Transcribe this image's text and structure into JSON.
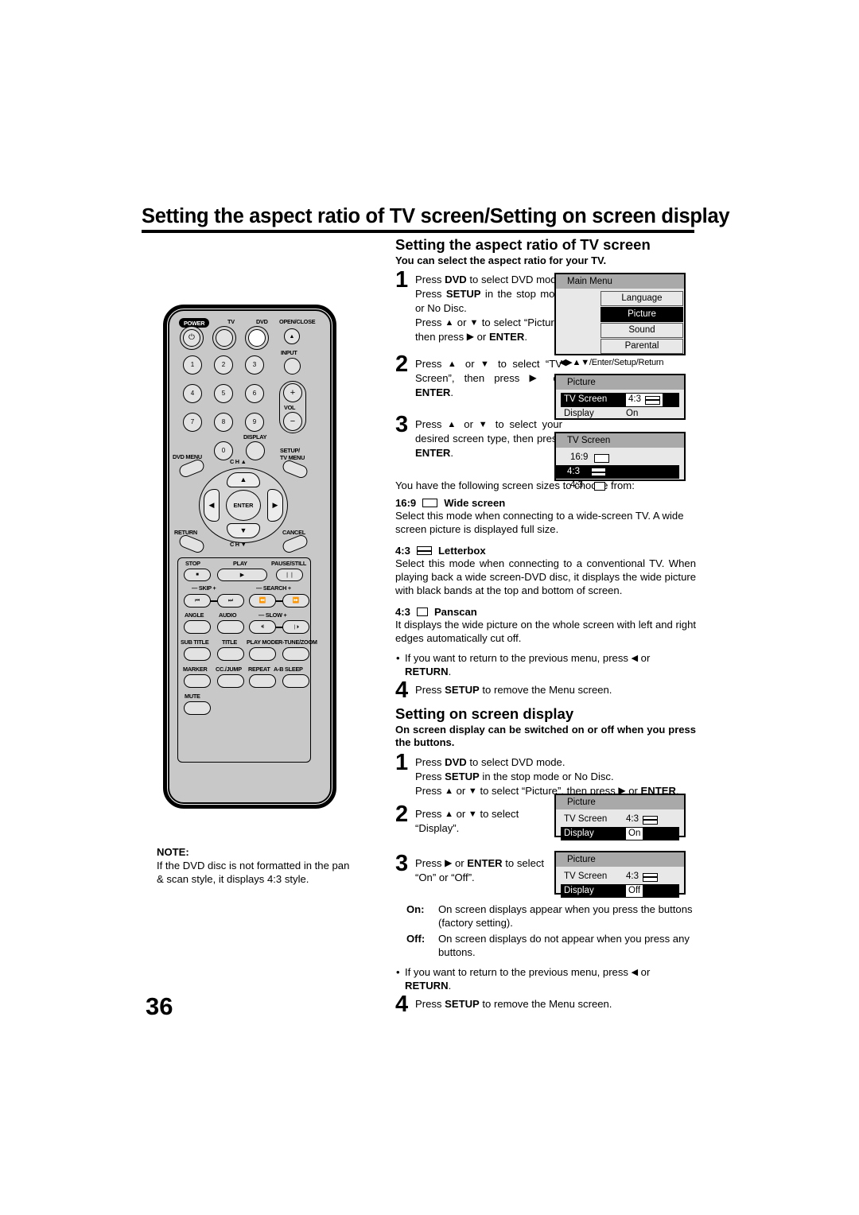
{
  "document": {
    "main_title": "Setting the aspect ratio of TV screen/Setting on screen display",
    "page_number": "36"
  },
  "note": {
    "heading": "NOTE:",
    "line1": "If the DVD disc is not formatted in the pan",
    "line2": "& scan style, it displays 4:3 style."
  },
  "section1": {
    "heading": "Setting the aspect ratio of TV screen",
    "subheading": "You can select the aspect ratio for your TV.",
    "steps": [
      {
        "num": "1",
        "lines": [
          {
            "pre": "Press ",
            "b1": "DVD",
            "mid": " to select DVD mode."
          },
          {
            "pre": "Press ",
            "b1": "SETUP",
            "mid": " in the stop mode or No Disc."
          },
          {
            "pre": "Press ",
            "arrow_up": "▲",
            "mid": " or ",
            "arrow_down": "▼",
            "post": " to select “Picture”, then press ",
            "arrow_right": "▶",
            "tail": " or ",
            "b2": "ENTER",
            "end": "."
          }
        ]
      },
      {
        "num": "2",
        "lines": [
          {
            "pre": "Press ",
            "arrow_up": "▲",
            "mid": " or ",
            "arrow_down": "▼",
            "post": " to select “TV Screen”, then press ",
            "arrow_right": "▶",
            "tail": " or ",
            "b2": "ENTER",
            "end": "."
          }
        ]
      },
      {
        "num": "3",
        "lines": [
          {
            "pre": "Press ",
            "arrow_up": "▲",
            "mid": " or ",
            "arrow_down": "▼",
            "post": " to select your desired screen type, then press ",
            "b2": "ENTER",
            "end": "."
          }
        ]
      }
    ],
    "choose_intro": "You have the following screen sizes to choose from:",
    "modes": [
      {
        "ratio": "16:9",
        "icon": "aspect-16-9-icon",
        "name": "Wide screen",
        "body": "Select this mode when connecting to a wide-screen TV. A wide screen picture is displayed full size."
      },
      {
        "ratio": "4:3",
        "icon": "aspect-4-3-letterbox-icon",
        "name": "Letterbox",
        "body": "Select this mode when connecting to a conventional TV. When playing back a wide screen-DVD disc, it displays the wide picture with black bands at the top and bottom of screen."
      },
      {
        "ratio": "4:3",
        "icon": "aspect-4-3-panscan-icon",
        "name": "Panscan",
        "body": "It displays the wide picture on the whole screen with left and right edges automatically cut off."
      }
    ],
    "return_bullet": {
      "pre": "If you want to return to the previous menu, press ",
      "arrow_left": "◀",
      "mid": " or ",
      "bold": "RETURN",
      "end": "."
    },
    "step4": {
      "num": "4",
      "pre": "Press ",
      "bold": "SETUP",
      "post": " to remove the Menu screen."
    }
  },
  "section2": {
    "heading": "Setting on screen display",
    "subheading": "On screen display can be switched on or off when you press the buttons.",
    "steps": [
      {
        "num": "1",
        "lines": [
          {
            "pre": "Press ",
            "b1": "DVD",
            "mid": " to select DVD mode."
          },
          {
            "pre": "Press ",
            "b1": "SETUP",
            "mid": " in the stop mode or No Disc."
          },
          {
            "pre": "Press ",
            "arrow_up": "▲",
            "mid": " or ",
            "arrow_down": "▼",
            "post": " to select “Picture”, then press ",
            "arrow_right": "▶",
            "tail": " or ",
            "b2": "ENTER",
            "end": "."
          }
        ]
      },
      {
        "num": "2",
        "lines": [
          {
            "pre": "Press ",
            "arrow_up": "▲",
            "mid": " or ",
            "arrow_down": "▼",
            "post": " to select “Display”."
          }
        ]
      },
      {
        "num": "3",
        "lines": [
          {
            "pre": "Press ",
            "arrow_right": "▶",
            "mid": " or ",
            "b2": "ENTER",
            "post": " to select “On” or “Off”."
          }
        ]
      }
    ],
    "definitions": [
      {
        "key": "On:",
        "value": "On screen displays appear when you press the buttons (factory setting)."
      },
      {
        "key": "Off:",
        "value": "On screen displays do not appear when you press any buttons."
      }
    ],
    "return_bullet": {
      "pre": "If you want to return to the previous menu, press ",
      "arrow_left": "◀",
      "mid": " or ",
      "bold": "RETURN",
      "end": "."
    },
    "step4": {
      "num": "4",
      "pre": "Press ",
      "bold": "SETUP",
      "post": " to remove the Menu screen."
    }
  },
  "osd_screens": {
    "main_menu": {
      "title": "Main Menu",
      "items": [
        {
          "label": "Language",
          "highlighted": false
        },
        {
          "label": "Picture",
          "highlighted": true
        },
        {
          "label": "Sound",
          "highlighted": false
        },
        {
          "label": "Parental",
          "highlighted": false
        }
      ],
      "hint": "◀▶▲▼/Enter/Setup/Return"
    },
    "picture_tvscreen": {
      "title": "Picture",
      "rows": [
        {
          "label": "TV Screen",
          "value": "4:3",
          "icon": "aspect-4-3-letterbox-icon",
          "highlighted": true,
          "boxed": true
        },
        {
          "label": "Display",
          "value": "On",
          "icon": "",
          "highlighted": false,
          "boxed": false
        }
      ]
    },
    "tv_screen": {
      "title": "TV Screen",
      "options": [
        {
          "label": "16:9",
          "icon": "aspect-16-9-icon",
          "highlighted": false
        },
        {
          "label": "4:3",
          "icon": "aspect-4-3-letterbox-icon",
          "highlighted": true
        },
        {
          "label": "4:3",
          "icon": "aspect-4-3-panscan-icon",
          "highlighted": false
        }
      ]
    },
    "picture_display_on": {
      "title": "Picture",
      "rows": [
        {
          "label": "TV Screen",
          "value": "4:3",
          "icon": "aspect-4-3-letterbox-icon",
          "highlighted": false,
          "boxed": false
        },
        {
          "label": "Display",
          "value": "On",
          "icon": "",
          "highlighted": true,
          "boxed": true
        }
      ]
    },
    "picture_display_off": {
      "title": "Picture",
      "rows": [
        {
          "label": "TV Screen",
          "value": "4:3",
          "icon": "aspect-4-3-letterbox-icon",
          "highlighted": false,
          "boxed": false
        },
        {
          "label": "Display",
          "value": "Off",
          "icon": "",
          "highlighted": true,
          "boxed": true
        }
      ]
    }
  },
  "remote": {
    "labels": {
      "power": "POWER",
      "tv": "TV",
      "dvd": "DVD",
      "open_close": "OPEN/CLOSE",
      "input": "INPUT",
      "vol": "VOL",
      "display": "DISPLAY",
      "dvd_menu": "DVD MENU",
      "setup_tv_menu_1": "SETUP/",
      "setup_tv_menu_2": "TV MENU",
      "ch_up": "C H ▲",
      "ch_down": "C H ▼",
      "return": "RETURN",
      "cancel": "CANCEL",
      "enter": "ENTER",
      "stop": "STOP",
      "play": "PLAY",
      "pause_still": "PAUSE/STILL",
      "skip": "— SKIP +",
      "search": "— SEARCH +",
      "angle": "ANGLE",
      "audio": "AUDIO",
      "slow": "— SLOW +",
      "sub_title": "SUB TITLE",
      "title": "TITLE",
      "play_mode": "PLAY MODE",
      "r_tune_zoom": "R-TUNE/ZOOM",
      "marker": "MARKER",
      "cc_jump": "CC./JUMP",
      "repeat": "REPEAT",
      "a_b": "A-B",
      "sleep": "SLEEP",
      "mute": "MUTE"
    },
    "numbers": [
      "1",
      "2",
      "3",
      "4",
      "5",
      "6",
      "7",
      "8",
      "9",
      "0"
    ],
    "glyphs": {
      "power": "⏻",
      "eject": "▲",
      "plus": "+",
      "minus": "−",
      "stop": "■",
      "play": "▶",
      "pause": "❘❘",
      "skip_prev": "⏮",
      "skip_next": "⏭",
      "search_rev": "⏪",
      "search_fwd": "⏩",
      "slow_rev": "⏴❘",
      "slow_fwd": "❘⏵",
      "up": "▲",
      "down": "▼",
      "left": "◀",
      "right": "▶"
    }
  }
}
